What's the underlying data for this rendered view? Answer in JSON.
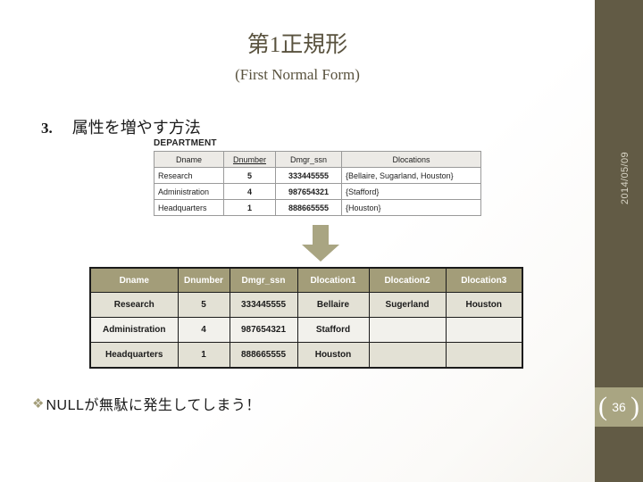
{
  "slide": {
    "title": "第1正規形",
    "subtitle": "(First Normal Form)",
    "section": {
      "number": "3.",
      "text": "属性を増やす方法"
    },
    "bullet": {
      "mark": "❖",
      "text": "NULLが無駄に発生してしまう！"
    }
  },
  "sidebar": {
    "date": "2014/05/09",
    "page_number": "36",
    "paren_left": "(",
    "paren_right": ")",
    "bg_color": "#625B45",
    "badge_color": "#A9A582"
  },
  "dept_figure": {
    "caption": "DEPARTMENT",
    "columns": [
      "Dname",
      "Dnumber",
      "Dmgr_ssn",
      "Dlocations"
    ],
    "primary_key": "Dnumber",
    "rows": [
      [
        "Research",
        "5",
        "333445555",
        "{Bellaire, Sugarland, Houston}"
      ],
      [
        "Administration",
        "4",
        "987654321",
        "{Stafford}"
      ],
      [
        "Headquarters",
        "1",
        "888665555",
        "{Houston}"
      ]
    ]
  },
  "result_table": {
    "header_color": "#A39D79",
    "columns": [
      "Dname",
      "Dnumber",
      "Dmgr_ssn",
      "Dlocation1",
      "Dlocation2",
      "Dlocation3"
    ],
    "rows": [
      [
        "Research",
        "5",
        "333445555",
        "Bellaire",
        "Sugerland",
        "Houston"
      ],
      [
        "Administration",
        "4",
        "987654321",
        "Stafford",
        "",
        ""
      ],
      [
        "Headquarters",
        "1",
        "888665555",
        "Houston",
        "",
        ""
      ]
    ]
  },
  "arrow": {
    "direction": "down",
    "color": "#A9A582"
  }
}
